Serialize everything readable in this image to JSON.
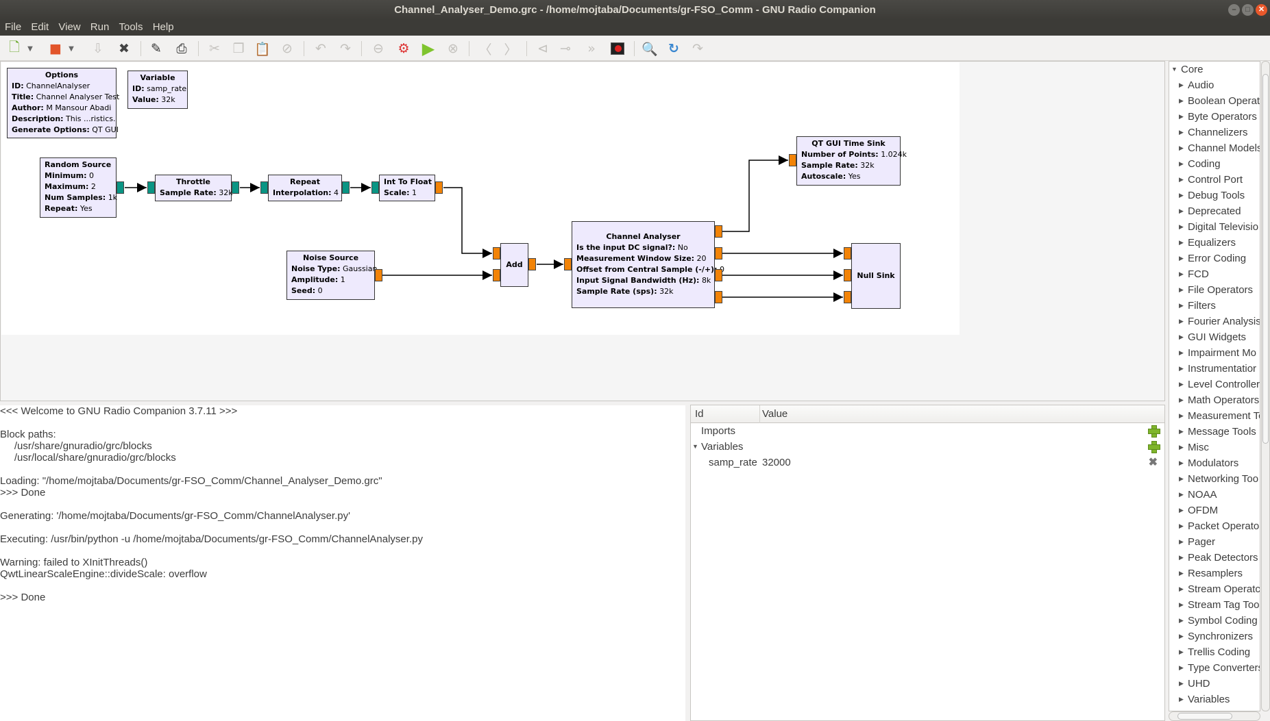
{
  "window": {
    "title": "Channel_Analyser_Demo.grc - /home/mojtaba/Documents/gr-FSO_Comm - GNU Radio Companion"
  },
  "menu": [
    "File",
    "Edit",
    "View",
    "Run",
    "Tools",
    "Help"
  ],
  "toolbar": [
    {
      "name": "new-flowgraph",
      "icon": "new-document-icon",
      "enabled": true
    },
    {
      "name": "new-dropdown",
      "icon": "dropdown-arrow-icon",
      "enabled": true
    },
    {
      "name": "open-flowgraph",
      "icon": "open-folder-icon",
      "enabled": true
    },
    {
      "name": "open-dropdown",
      "icon": "dropdown-arrow-icon",
      "enabled": true
    },
    {
      "name": "save",
      "icon": "save-icon",
      "enabled": false
    },
    {
      "name": "close",
      "icon": "close-x-icon",
      "enabled": true
    },
    {
      "name": "properties",
      "icon": "pencil-icon",
      "enabled": true
    },
    {
      "name": "print",
      "icon": "printer-icon",
      "enabled": true
    },
    {
      "name": "cut",
      "icon": "scissors-icon",
      "enabled": false
    },
    {
      "name": "copy",
      "icon": "copy-icon",
      "enabled": false
    },
    {
      "name": "paste",
      "icon": "paste-icon",
      "enabled": false
    },
    {
      "name": "delete",
      "icon": "delete-icon",
      "enabled": false
    },
    {
      "name": "undo",
      "icon": "undo-icon",
      "enabled": false
    },
    {
      "name": "redo",
      "icon": "redo-icon",
      "enabled": false
    },
    {
      "name": "disable-block",
      "icon": "disable-icon",
      "enabled": false
    },
    {
      "name": "generate",
      "icon": "generate-icon",
      "enabled": true
    },
    {
      "name": "execute",
      "icon": "play-icon",
      "enabled": true
    },
    {
      "name": "kill",
      "icon": "stop-icon",
      "enabled": false
    },
    {
      "name": "rotate-ccw",
      "icon": "rotate-left-icon",
      "enabled": false
    },
    {
      "name": "rotate-cw",
      "icon": "rotate-right-icon",
      "enabled": false
    },
    {
      "name": "enable-block",
      "icon": "enable-icon",
      "enabled": false
    },
    {
      "name": "bypass-block",
      "icon": "bypass-icon",
      "enabled": false
    },
    {
      "name": "forward",
      "icon": "forward-icon",
      "enabled": false
    },
    {
      "name": "error-log",
      "icon": "error-icon",
      "enabled": true
    },
    {
      "name": "find-block",
      "icon": "search-icon",
      "enabled": true
    },
    {
      "name": "reload",
      "icon": "reload-icon",
      "enabled": true
    },
    {
      "name": "redo-disabled",
      "icon": "redo-arrow-icon",
      "enabled": false
    }
  ],
  "colors": {
    "block_fill": "#eeeafd",
    "port_int": "#0a9584",
    "port_float": "#f28307",
    "titlebar": "#3c3b37",
    "close_button": "#e9582b"
  },
  "blocks": {
    "options": {
      "title": "Options",
      "params": [
        {
          "k": "ID:",
          "v": "ChannelAnalyser"
        },
        {
          "k": "Title:",
          "v": "Channel Analyser Test"
        },
        {
          "k": "Author:",
          "v": "M Mansour Abadi"
        },
        {
          "k": "Description:",
          "v": "This ...ristics."
        },
        {
          "k": "Generate Options:",
          "v": "QT GUI"
        }
      ]
    },
    "variable": {
      "title": "Variable",
      "params": [
        {
          "k": "ID:",
          "v": "samp_rate"
        },
        {
          "k": "Value:",
          "v": "32k"
        }
      ]
    },
    "random_source": {
      "title": "Random Source",
      "params": [
        {
          "k": "Minimum:",
          "v": "0"
        },
        {
          "k": "Maximum:",
          "v": "2"
        },
        {
          "k": "Num Samples:",
          "v": "1k"
        },
        {
          "k": "Repeat:",
          "v": "Yes"
        }
      ]
    },
    "throttle": {
      "title": "Throttle",
      "params": [
        {
          "k": "Sample Rate:",
          "v": "32k"
        }
      ]
    },
    "repeat": {
      "title": "Repeat",
      "params": [
        {
          "k": "Interpolation:",
          "v": "4"
        }
      ]
    },
    "int_to_float": {
      "title": "Int To Float",
      "params": [
        {
          "k": "Scale:",
          "v": "1"
        }
      ]
    },
    "noise_source": {
      "title": "Noise Source",
      "params": [
        {
          "k": "Noise Type:",
          "v": "Gaussian"
        },
        {
          "k": "Amplitude:",
          "v": "1"
        },
        {
          "k": "Seed:",
          "v": "0"
        }
      ]
    },
    "add": {
      "title": "Add"
    },
    "channel_analyser": {
      "title": "Channel Analyser",
      "params": [
        {
          "k": "Is the input DC signal?:",
          "v": "No"
        },
        {
          "k": "Measurement Window Size:",
          "v": "20"
        },
        {
          "k": "Offset from Central Sample (-/+):",
          "v": "0"
        },
        {
          "k": "Input Signal Bandwidth (Hz):",
          "v": "8k"
        },
        {
          "k": "Sample Rate (sps):",
          "v": "32k"
        }
      ]
    },
    "qt_time_sink": {
      "title": "QT GUI Time Sink",
      "params": [
        {
          "k": "Number of Points:",
          "v": "1.024k"
        },
        {
          "k": "Sample Rate:",
          "v": "32k"
        },
        {
          "k": "Autoscale:",
          "v": "Yes"
        }
      ]
    },
    "null_sink": {
      "title": "Null Sink"
    }
  },
  "console": {
    "lines": [
      "<<< Welcome to GNU Radio Companion 3.7.11 >>>",
      "",
      "Block paths:",
      "     /usr/share/gnuradio/grc/blocks",
      "     /usr/local/share/gnuradio/grc/blocks",
      "",
      "Loading: \"/home/mojtaba/Documents/gr-FSO_Comm/Channel_Analyser_Demo.grc\"",
      ">>> Done",
      "",
      "Generating: '/home/mojtaba/Documents/gr-FSO_Comm/ChannelAnalyser.py'",
      "",
      "Executing: /usr/bin/python -u /home/mojtaba/Documents/gr-FSO_Comm/ChannelAnalyser.py",
      "",
      "Warning: failed to XInitThreads()",
      "QwtLinearScaleEngine::divideScale: overflow",
      "",
      ">>> Done"
    ]
  },
  "variables_panel": {
    "col_id": "Id",
    "col_value": "Value",
    "imports_label": "Imports",
    "variables_label": "Variables",
    "rows": [
      {
        "id": "samp_rate",
        "value": "32000"
      }
    ]
  },
  "block_tree": {
    "root": "Core",
    "items": [
      "Audio",
      "Boolean Operat",
      "Byte Operators",
      "Channelizers",
      "Channel Models",
      "Coding",
      "Control Port",
      "Debug Tools",
      "Deprecated",
      "Digital Televisio",
      "Equalizers",
      "Error Coding",
      "FCD",
      "File Operators",
      "Filters",
      "Fourier Analysis",
      "GUI Widgets",
      "Impairment Mo",
      "Instrumentatior",
      "Level Controller",
      "Math Operators",
      "Measurement Tc",
      "Message Tools",
      "Misc",
      "Modulators",
      "Networking Too",
      "NOAA",
      "OFDM",
      "Packet Operato",
      "Pager",
      "Peak Detectors",
      "Resamplers",
      "Stream Operatc",
      "Stream Tag Tool",
      "Symbol Coding",
      "Synchronizers",
      "Trellis Coding",
      "Type Converters",
      "UHD",
      "Variables"
    ]
  }
}
